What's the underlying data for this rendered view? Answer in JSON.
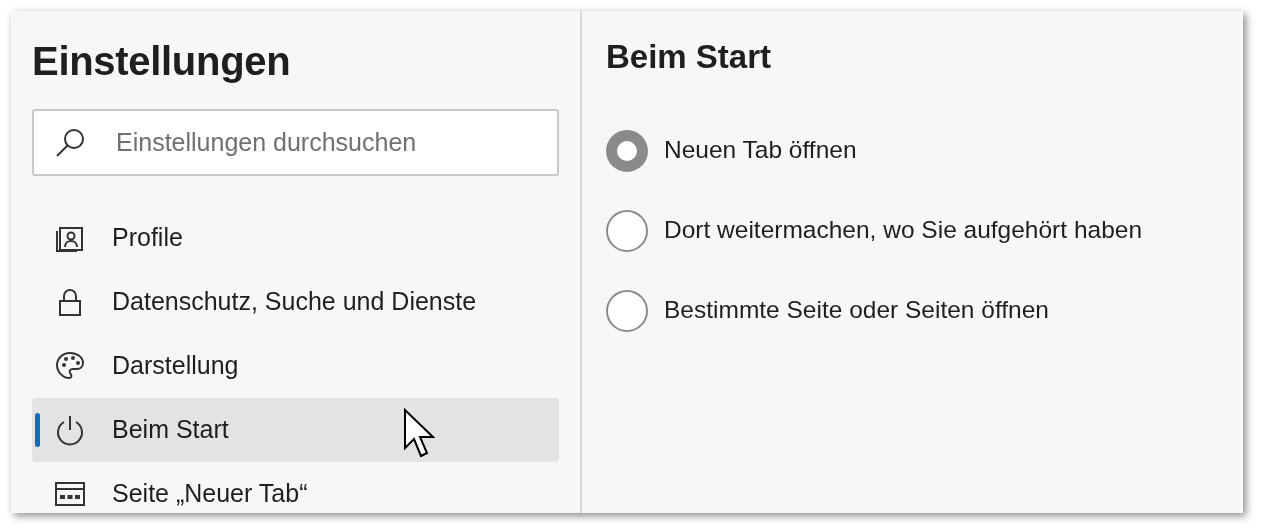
{
  "sidebar": {
    "title": "Einstellungen",
    "search": {
      "placeholder": "Einstellungen durchsuchen"
    },
    "items": [
      {
        "kind": "profile",
        "label": "Profile",
        "selected": false
      },
      {
        "kind": "lock",
        "label": "Datenschutz, Suche und Dienste",
        "selected": false
      },
      {
        "kind": "palette",
        "label": "Darstellung",
        "selected": false
      },
      {
        "kind": "power",
        "label": "Beim Start",
        "selected": true
      },
      {
        "kind": "newtab",
        "label": "Seite „Neuer Tab“",
        "selected": false
      }
    ]
  },
  "content": {
    "title": "Beim Start",
    "options": [
      {
        "label": "Neuen Tab öffnen",
        "selected": true
      },
      {
        "label": "Dort weitermachen, wo Sie aufgehört haben",
        "selected": false
      },
      {
        "label": "Bestimmte Seite oder Seiten öffnen",
        "selected": false
      }
    ]
  }
}
